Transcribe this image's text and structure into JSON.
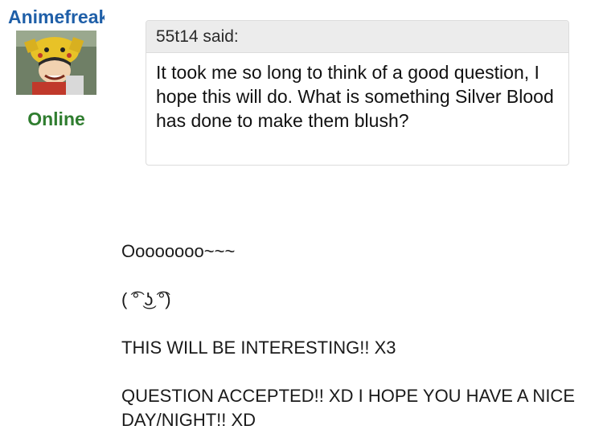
{
  "user": {
    "name": "Animefreak",
    "status": "Online",
    "avatar_icon": "avatar-image"
  },
  "quote": {
    "author_line": "55t14 said:",
    "text": "It took me so long to think of a good question, I hope this will do. What is something Silver Blood has done to make them blush?"
  },
  "message": {
    "lines": [
      "Oooooooo~~~",
      "( ͡° ͜ʖ ͡°)",
      "THIS WILL BE INTERESTING!! X3",
      "QUESTION ACCEPTED!! XD I HOPE YOU HAVE A NICE DAY/NIGHT!! XD"
    ]
  },
  "colors": {
    "username": "#1f5fa8",
    "online": "#2f7d2f",
    "quote_header_bg": "#ececec",
    "quote_border": "#dcdcdc"
  }
}
